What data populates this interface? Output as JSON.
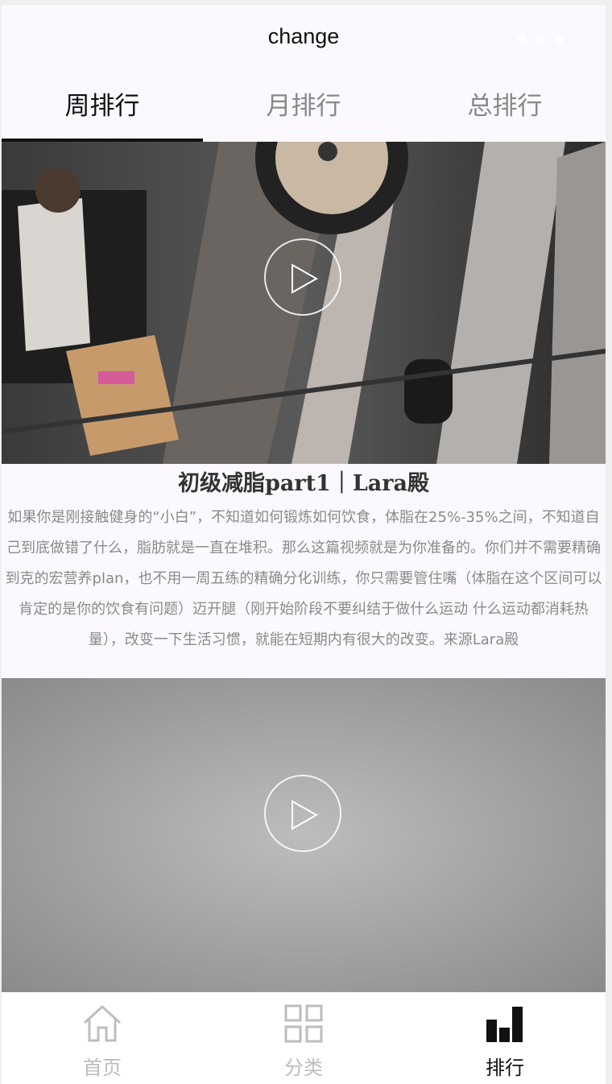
{
  "window": {
    "title": "change"
  },
  "tabs": [
    {
      "label": "周排行",
      "active": true
    },
    {
      "label": "月排行",
      "active": false
    },
    {
      "label": "总排行",
      "active": false
    }
  ],
  "videos": [
    {
      "title": "初级减脂part1｜Lara殿",
      "description": "如果你是刚接触健身的“小白”，不知道如何锻炼如何饮食，体脂在25%-35%之间，不知道自己到底做错了什么，脂肪就是一直在堆积。那么这篇视频就是为你准备的。你们并不需要精确到克的宏营养plan，也不用一周五练的精确分化训练，你只需要管住嘴（体脂在这个区间可以肯定的是你的饮食有问题）迈开腿（刚开始阶段不要纠结于做什么运动 什么运动都消耗热量），改变一下生活习惯，就能在短期内有很大的改变。来源Lara殿"
    },
    {
      "title": "",
      "description": ""
    }
  ],
  "bottom_nav": [
    {
      "label": "首页",
      "icon": "home-icon",
      "active": false
    },
    {
      "label": "分类",
      "icon": "grid-icon",
      "active": false
    },
    {
      "label": "排行",
      "icon": "bar-chart-icon",
      "active": true
    }
  ],
  "colors": {
    "accent": "#111111",
    "inactive": "#bdbdbd",
    "background": "#fbf9fd"
  }
}
